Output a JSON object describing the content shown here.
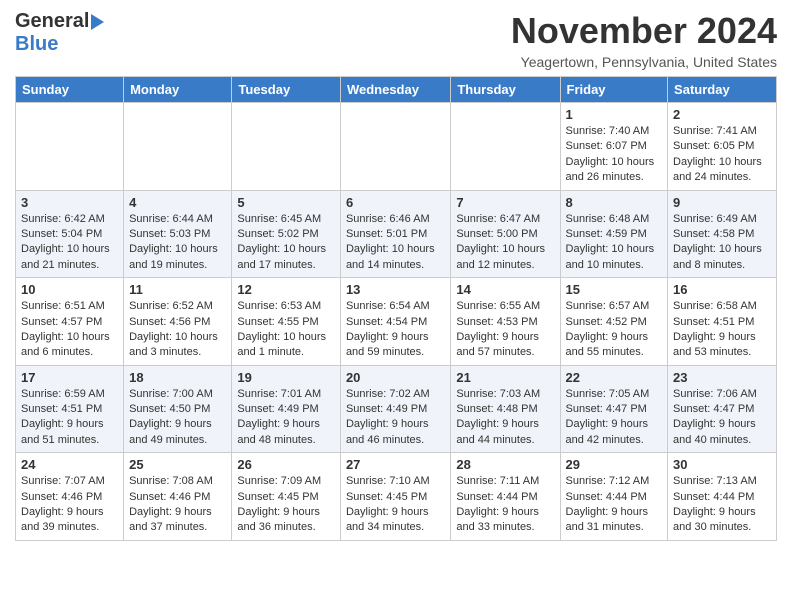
{
  "header": {
    "logo_general": "General",
    "logo_blue": "Blue",
    "month_title": "November 2024",
    "location": "Yeagertown, Pennsylvania, United States"
  },
  "days_of_week": [
    "Sunday",
    "Monday",
    "Tuesday",
    "Wednesday",
    "Thursday",
    "Friday",
    "Saturday"
  ],
  "weeks": [
    [
      {
        "day": "",
        "info": ""
      },
      {
        "day": "",
        "info": ""
      },
      {
        "day": "",
        "info": ""
      },
      {
        "day": "",
        "info": ""
      },
      {
        "day": "",
        "info": ""
      },
      {
        "day": "1",
        "info": "Sunrise: 7:40 AM\nSunset: 6:07 PM\nDaylight: 10 hours and 26 minutes."
      },
      {
        "day": "2",
        "info": "Sunrise: 7:41 AM\nSunset: 6:05 PM\nDaylight: 10 hours and 24 minutes."
      }
    ],
    [
      {
        "day": "3",
        "info": "Sunrise: 6:42 AM\nSunset: 5:04 PM\nDaylight: 10 hours and 21 minutes."
      },
      {
        "day": "4",
        "info": "Sunrise: 6:44 AM\nSunset: 5:03 PM\nDaylight: 10 hours and 19 minutes."
      },
      {
        "day": "5",
        "info": "Sunrise: 6:45 AM\nSunset: 5:02 PM\nDaylight: 10 hours and 17 minutes."
      },
      {
        "day": "6",
        "info": "Sunrise: 6:46 AM\nSunset: 5:01 PM\nDaylight: 10 hours and 14 minutes."
      },
      {
        "day": "7",
        "info": "Sunrise: 6:47 AM\nSunset: 5:00 PM\nDaylight: 10 hours and 12 minutes."
      },
      {
        "day": "8",
        "info": "Sunrise: 6:48 AM\nSunset: 4:59 PM\nDaylight: 10 hours and 10 minutes."
      },
      {
        "day": "9",
        "info": "Sunrise: 6:49 AM\nSunset: 4:58 PM\nDaylight: 10 hours and 8 minutes."
      }
    ],
    [
      {
        "day": "10",
        "info": "Sunrise: 6:51 AM\nSunset: 4:57 PM\nDaylight: 10 hours and 6 minutes."
      },
      {
        "day": "11",
        "info": "Sunrise: 6:52 AM\nSunset: 4:56 PM\nDaylight: 10 hours and 3 minutes."
      },
      {
        "day": "12",
        "info": "Sunrise: 6:53 AM\nSunset: 4:55 PM\nDaylight: 10 hours and 1 minute."
      },
      {
        "day": "13",
        "info": "Sunrise: 6:54 AM\nSunset: 4:54 PM\nDaylight: 9 hours and 59 minutes."
      },
      {
        "day": "14",
        "info": "Sunrise: 6:55 AM\nSunset: 4:53 PM\nDaylight: 9 hours and 57 minutes."
      },
      {
        "day": "15",
        "info": "Sunrise: 6:57 AM\nSunset: 4:52 PM\nDaylight: 9 hours and 55 minutes."
      },
      {
        "day": "16",
        "info": "Sunrise: 6:58 AM\nSunset: 4:51 PM\nDaylight: 9 hours and 53 minutes."
      }
    ],
    [
      {
        "day": "17",
        "info": "Sunrise: 6:59 AM\nSunset: 4:51 PM\nDaylight: 9 hours and 51 minutes."
      },
      {
        "day": "18",
        "info": "Sunrise: 7:00 AM\nSunset: 4:50 PM\nDaylight: 9 hours and 49 minutes."
      },
      {
        "day": "19",
        "info": "Sunrise: 7:01 AM\nSunset: 4:49 PM\nDaylight: 9 hours and 48 minutes."
      },
      {
        "day": "20",
        "info": "Sunrise: 7:02 AM\nSunset: 4:49 PM\nDaylight: 9 hours and 46 minutes."
      },
      {
        "day": "21",
        "info": "Sunrise: 7:03 AM\nSunset: 4:48 PM\nDaylight: 9 hours and 44 minutes."
      },
      {
        "day": "22",
        "info": "Sunrise: 7:05 AM\nSunset: 4:47 PM\nDaylight: 9 hours and 42 minutes."
      },
      {
        "day": "23",
        "info": "Sunrise: 7:06 AM\nSunset: 4:47 PM\nDaylight: 9 hours and 40 minutes."
      }
    ],
    [
      {
        "day": "24",
        "info": "Sunrise: 7:07 AM\nSunset: 4:46 PM\nDaylight: 9 hours and 39 minutes."
      },
      {
        "day": "25",
        "info": "Sunrise: 7:08 AM\nSunset: 4:46 PM\nDaylight: 9 hours and 37 minutes."
      },
      {
        "day": "26",
        "info": "Sunrise: 7:09 AM\nSunset: 4:45 PM\nDaylight: 9 hours and 36 minutes."
      },
      {
        "day": "27",
        "info": "Sunrise: 7:10 AM\nSunset: 4:45 PM\nDaylight: 9 hours and 34 minutes."
      },
      {
        "day": "28",
        "info": "Sunrise: 7:11 AM\nSunset: 4:44 PM\nDaylight: 9 hours and 33 minutes."
      },
      {
        "day": "29",
        "info": "Sunrise: 7:12 AM\nSunset: 4:44 PM\nDaylight: 9 hours and 31 minutes."
      },
      {
        "day": "30",
        "info": "Sunrise: 7:13 AM\nSunset: 4:44 PM\nDaylight: 9 hours and 30 minutes."
      }
    ]
  ]
}
